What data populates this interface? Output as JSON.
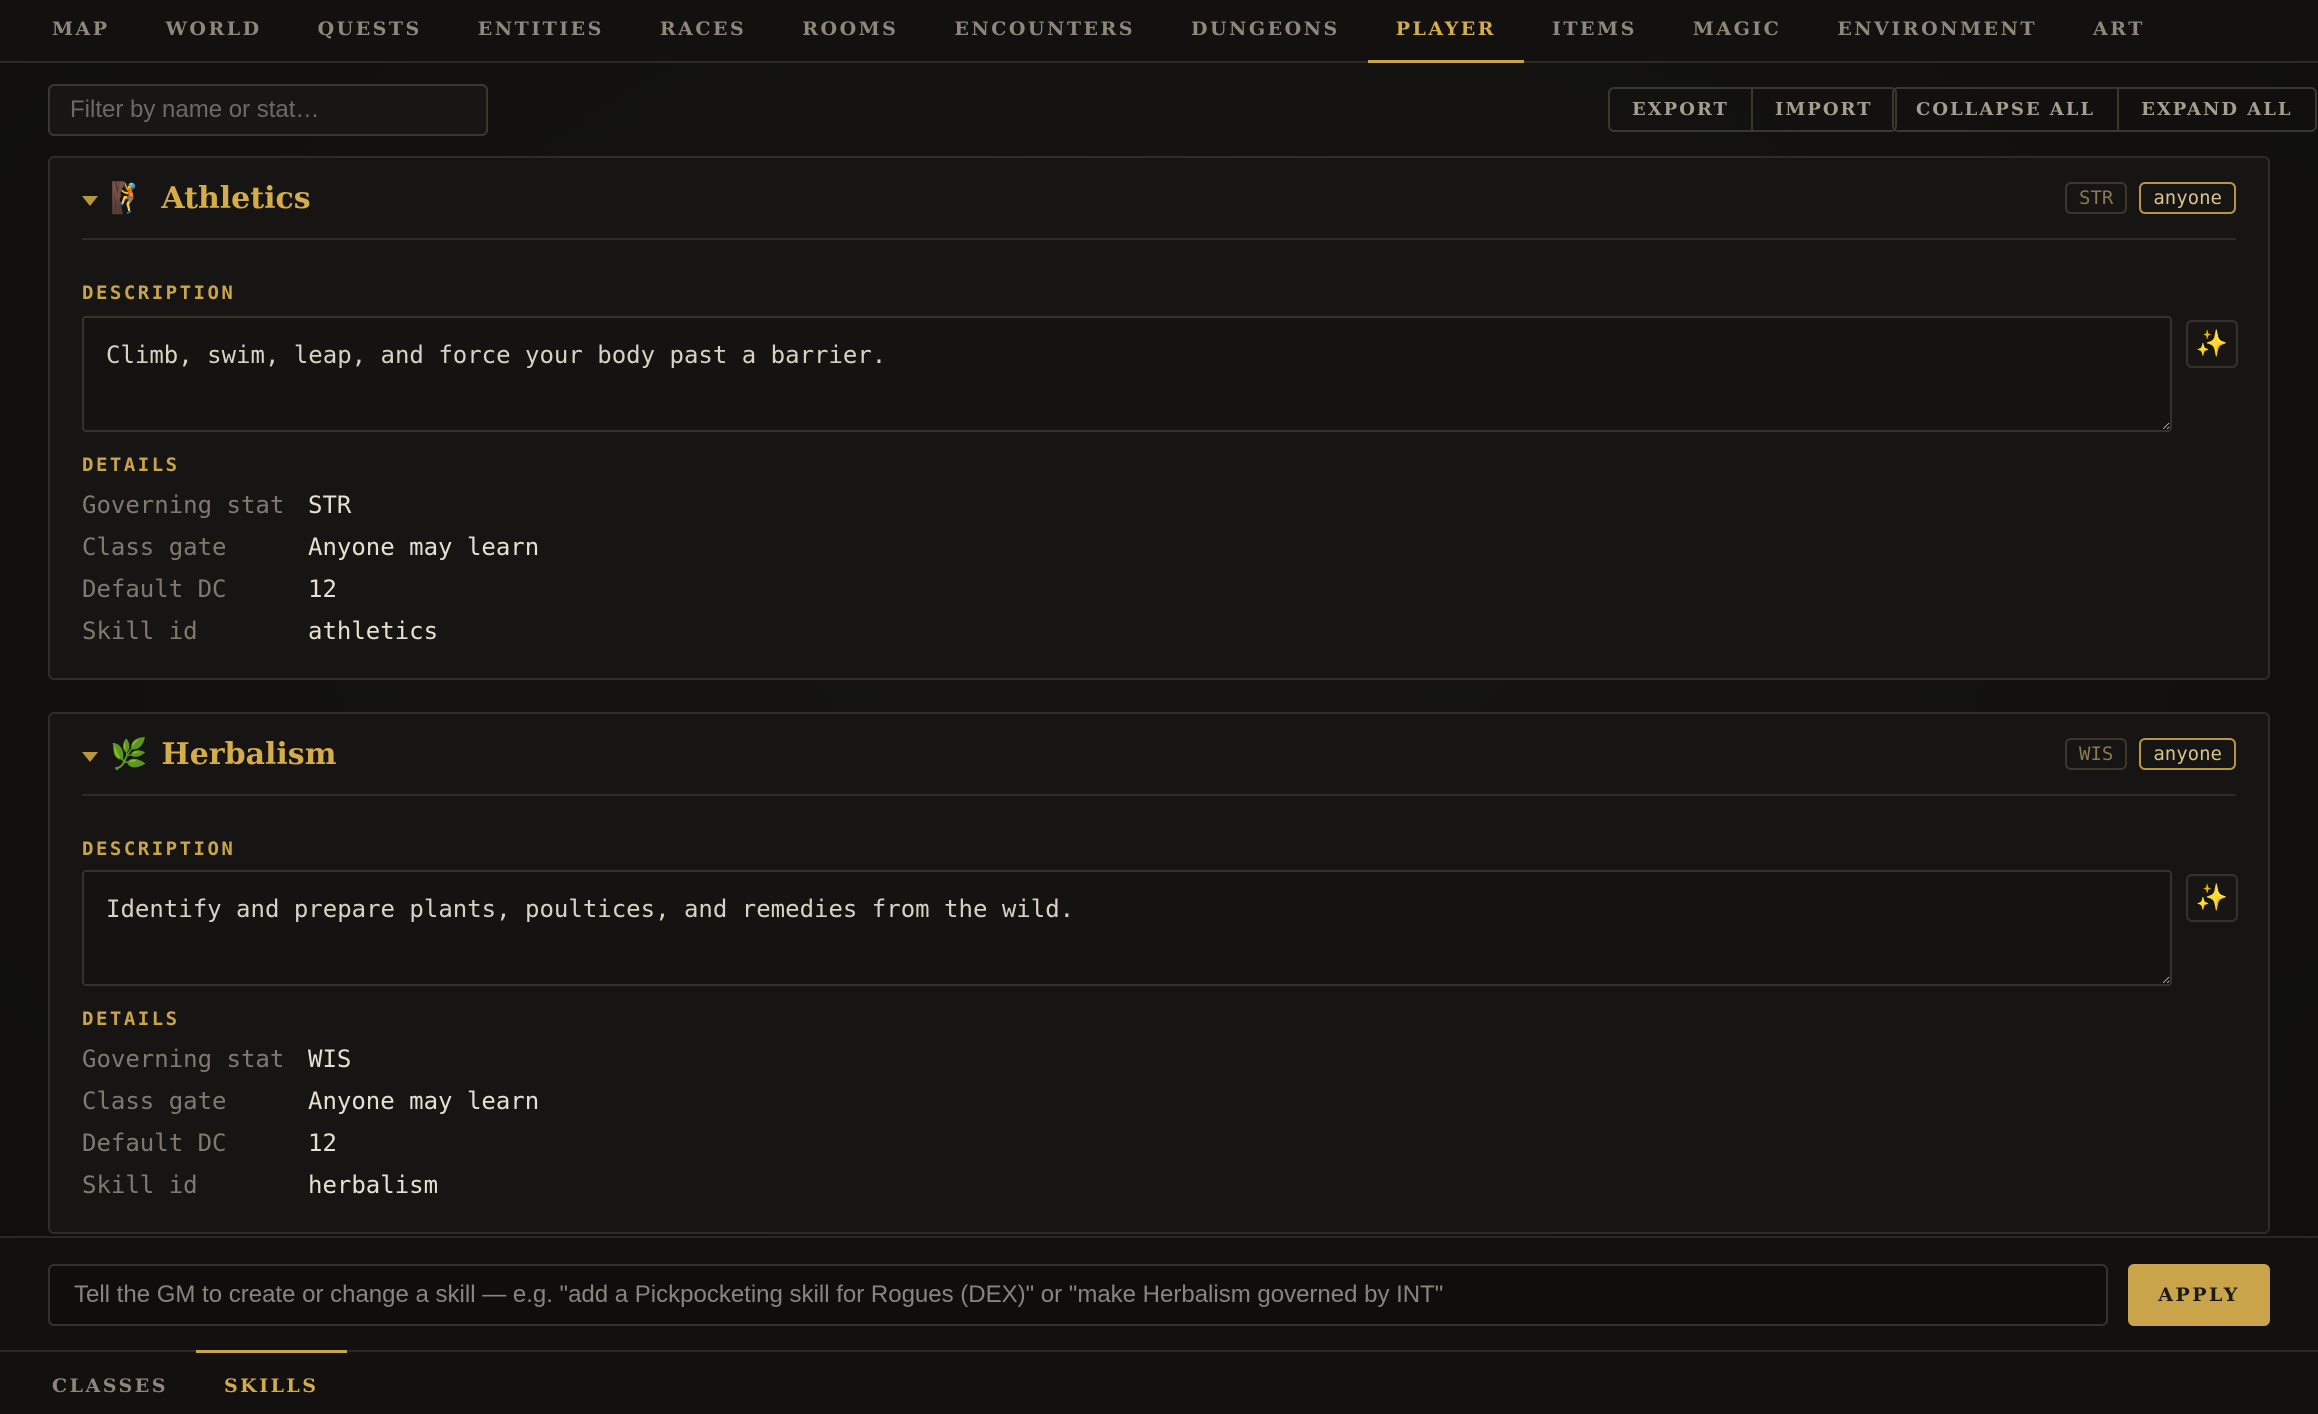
{
  "top_tabs": [
    {
      "label": "MAP"
    },
    {
      "label": "WORLD"
    },
    {
      "label": "QUESTS"
    },
    {
      "label": "ENTITIES"
    },
    {
      "label": "RACES"
    },
    {
      "label": "ROOMS"
    },
    {
      "label": "ENCOUNTERS"
    },
    {
      "label": "DUNGEONS"
    },
    {
      "label": "PLAYER",
      "active": true
    },
    {
      "label": "ITEMS"
    },
    {
      "label": "MAGIC"
    },
    {
      "label": "ENVIRONMENT"
    },
    {
      "label": "ART"
    }
  ],
  "toolbar": {
    "filter_placeholder": "Filter by name or stat…",
    "export_label": "EXPORT",
    "import_label": "IMPORT",
    "collapse_label": "COLLAPSE ALL",
    "expand_label": "EXPAND ALL"
  },
  "labels": {
    "description": "DESCRIPTION",
    "details": "DETAILS",
    "governing_stat": "Governing stat",
    "class_gate": "Class gate",
    "default_dc": "Default DC",
    "skill_id": "Skill id"
  },
  "skills": [
    {
      "icon": "🧗",
      "icon_name": "climbing-person-icon",
      "name": "Athletics",
      "stat_badge": "STR",
      "gate_badge": "anyone",
      "description": "Climb, swim, leap, and force your body past a barrier.",
      "governing_stat": "STR",
      "class_gate": "Anyone may learn",
      "default_dc": "12",
      "skill_id": "athletics"
    },
    {
      "icon": "🌿",
      "icon_name": "herb-icon",
      "name": "Herbalism",
      "stat_badge": "WIS",
      "gate_badge": "anyone",
      "description": "Identify and prepare plants, poultices, and remedies from the wild.",
      "governing_stat": "WIS",
      "class_gate": "Anyone may learn",
      "default_dc": "12",
      "skill_id": "herbalism"
    }
  ],
  "spark_icon": "✨",
  "gm_prompt": {
    "placeholder": "Tell the GM to create or change a skill — e.g. \"add a Pickpocketing skill for Rogues (DEX)\" or \"make Herbalism governed by INT\"",
    "apply_label": "APPLY"
  },
  "sub_tabs": [
    {
      "label": "CLASSES"
    },
    {
      "label": "SKILLS",
      "active": true
    }
  ],
  "colors": {
    "accent": "#c9a449",
    "background": "#121110",
    "text": "#d8d2c2"
  }
}
